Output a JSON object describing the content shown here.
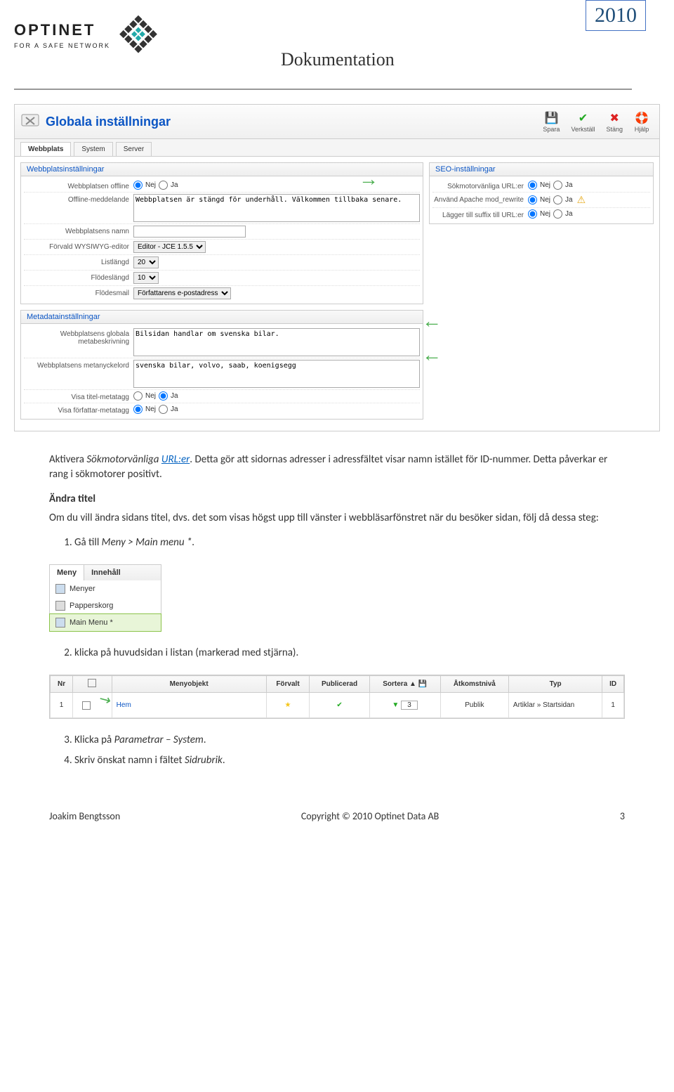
{
  "header": {
    "logo_name": "OPTINET",
    "logo_tagline": "FOR A SAFE NETWORK",
    "doc_title": "Dokumentation",
    "year": "2010"
  },
  "admin": {
    "title": "Globala inställningar",
    "toolbar": {
      "save": "Spara",
      "apply": "Verkställ",
      "close": "Stäng",
      "help": "Hjälp"
    },
    "tabs": {
      "site": "Webbplats",
      "system": "System",
      "server": "Server"
    },
    "site_legend": "Webbplatsinställningar",
    "seo_legend": "SEO-inställningar",
    "meta_legend": "Metadatainställningar",
    "labels": {
      "offline": "Webbplatsen offline",
      "offline_msg": "Offline-meddelande",
      "site_name": "Webbplatsens namn",
      "editor": "Förvald WYSIWYG-editor",
      "list_len": "Listlängd",
      "feed_len": "Flödeslängd",
      "feed_mail": "Flödesmail",
      "sef": "Sökmotorvänliga URL:er",
      "rewrite": "Använd Apache mod_rewrite",
      "suffix": "Lägger till suffix till URL:er",
      "meta_desc": "Webbplatsens globala metabeskrivning",
      "meta_keys": "Webbplatsens metanyckelord",
      "show_title": "Visa titel-metatagg",
      "show_author": "Visa författar-metatagg"
    },
    "values": {
      "nej": "Nej",
      "ja": "Ja",
      "offline_msg": "Webbplatsen är stängd för underhåll. Välkommen tillbaka senare.",
      "editor": "Editor - JCE 1.5.5",
      "list_len": "20",
      "feed_len": "10",
      "feed_mail": "Författarens e-postadress",
      "meta_desc": "Bilsidan handlar om svenska bilar.",
      "meta_keys": "svenska bilar, volvo, saab, koenigsegg"
    }
  },
  "body": {
    "p1a": "Aktivera ",
    "p1b": "Sökmotorvänliga ",
    "p1c": "URL:er",
    "p1d": ". Detta gör att sidornas adresser i adressfältet visar namn istället för ID-nummer. Detta påverkar er rang i sökmotorer positivt.",
    "h1": "Ändra titel",
    "p2": "Om du vill ändra sidans titel, dvs. det som visas högst upp till vänster i webbläsarfönstret när du besöker sidan, följ då dessa steg:",
    "li1a": "Gå till ",
    "li1b": "Meny > Main menu *.",
    "li2": "klicka på huvudsidan i listan (markerad med stjärna).",
    "li3a": "Klicka på ",
    "li3b": "Parametrar – System",
    "li3c": ".",
    "li4a": "Skriv önskat namn i fältet ",
    "li4b": "Sidrubrik",
    "li4c": "."
  },
  "menu": {
    "tab1": "Meny",
    "tab2": "Innehåll",
    "item1": "Menyer",
    "item2": "Papperskorg",
    "item3": "Main Menu *"
  },
  "table": {
    "h_nr": "Nr",
    "h_chk": "",
    "h_obj": "Menyobjekt",
    "h_def": "Förvalt",
    "h_pub": "Publicerad",
    "h_sort": "Sortera",
    "h_acc": "Åtkomstnivå",
    "h_type": "Typ",
    "h_id": "ID",
    "r1_nr": "1",
    "r1_obj": "Hem",
    "r1_sort": "3",
    "r1_acc": "Publik",
    "r1_type": "Artiklar » Startsidan",
    "r1_id": "1"
  },
  "footer": {
    "author": "Joakim Bengtsson",
    "copyright": "Copyright © 2010 Optinet Data AB",
    "page": "3"
  }
}
